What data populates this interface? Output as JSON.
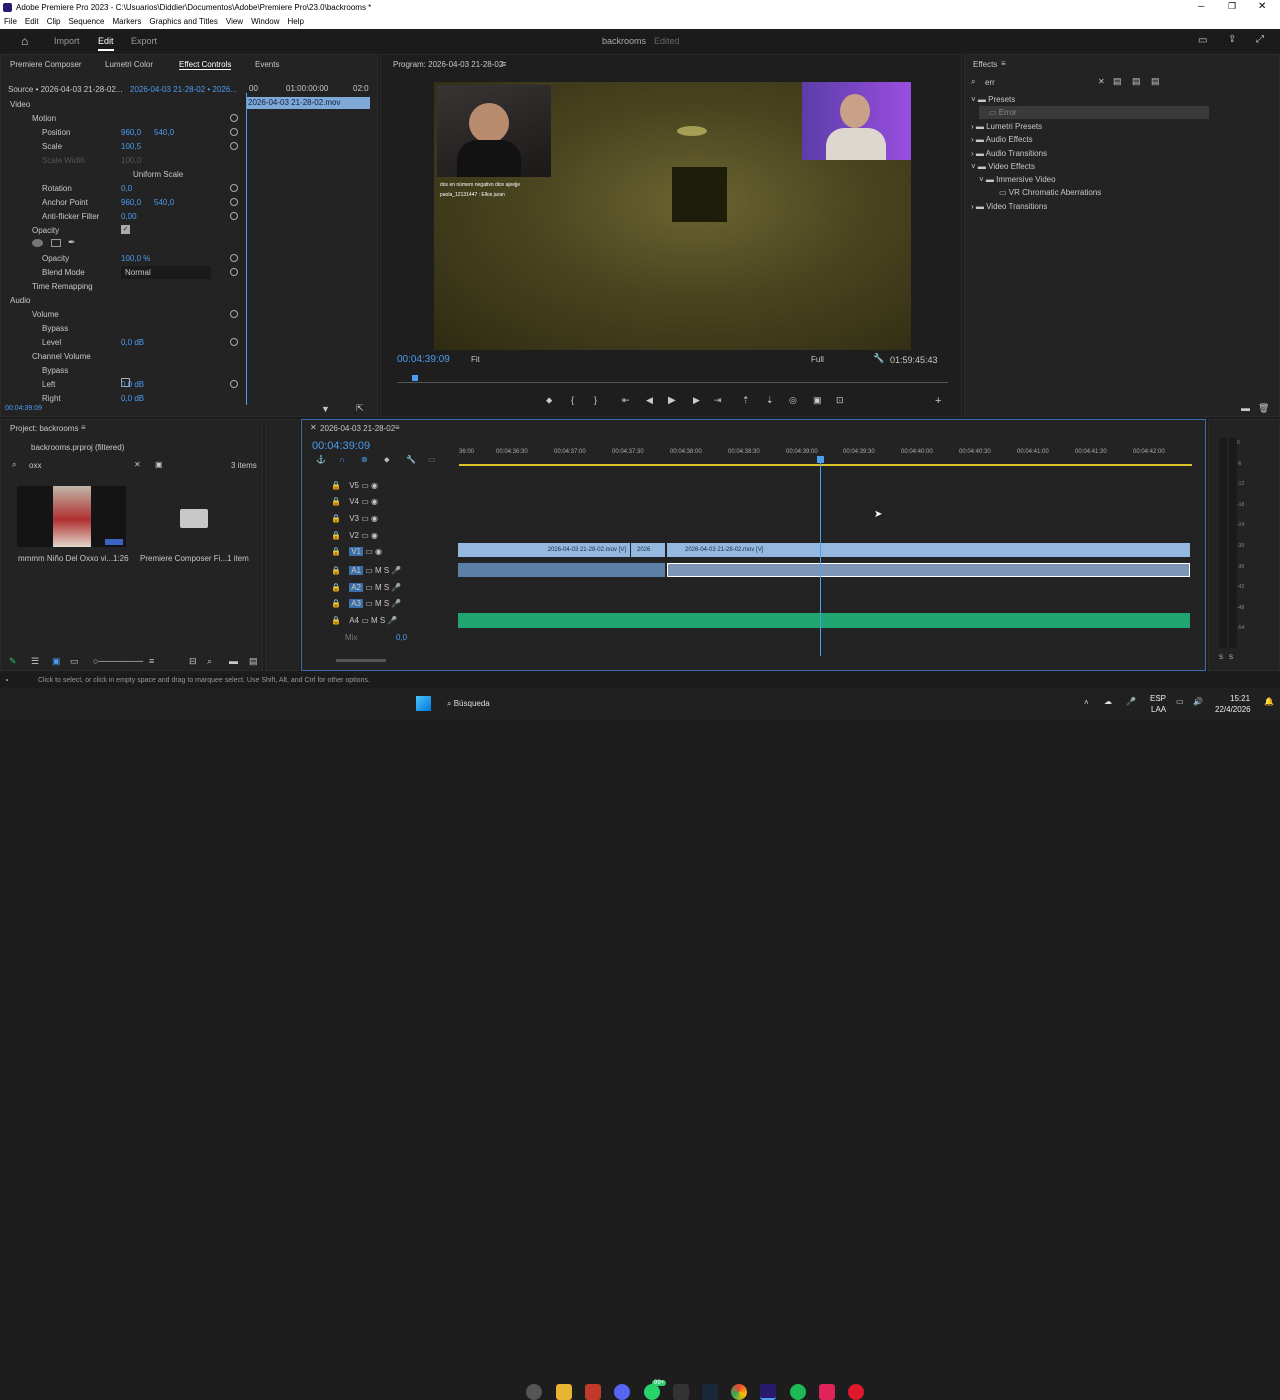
{
  "title": "Adobe Premiere Pro 2023 - C:\\Usuarios\\Diddier\\Documentos\\Adobe\\Premiere Pro\\23.0\\backrooms *",
  "menu": [
    "File",
    "Edit",
    "Clip",
    "Sequence",
    "Markers",
    "Graphics and Titles",
    "View",
    "Window",
    "Help"
  ],
  "header": {
    "tabs": [
      "Import",
      "Edit",
      "Export"
    ],
    "project": "backrooms",
    "status": "Edited"
  },
  "effect_controls": {
    "tabs": [
      "Premiere Composer",
      "Lumetri Color",
      "Effect Controls",
      "Events"
    ],
    "source": "Source • 2026-04-03 21-28-02...",
    "seq": "2026-04-03 21-28-02 • 2026...",
    "time_start": "00",
    "time_mid": "01:00:00:00",
    "time_end": "02:0",
    "clip": "2026-04-03 21-28-02.mov",
    "video": "Video",
    "motion": "Motion",
    "position": "Position",
    "pos_x": "960,0",
    "pos_y": "540,0",
    "scale": "Scale",
    "scale_v": "100,5",
    "scale_width": "Scale Width",
    "scale_width_v": "100,0",
    "uniform": "Uniform Scale",
    "rotation": "Rotation",
    "rotation_v": "0,0",
    "anchor": "Anchor Point",
    "anc_x": "960,0",
    "anc_y": "540,0",
    "antiflicker": "Anti-flicker Filter",
    "antiflicker_v": "0,00",
    "opacity_sec": "Opacity",
    "opacity": "Opacity",
    "opacity_v": "100,0 %",
    "blend": "Blend Mode",
    "blend_v": "Normal",
    "timeremap": "Time Remapping",
    "audio": "Audio",
    "volume": "Volume",
    "bypass": "Bypass",
    "level": "Level",
    "level_v": "0,0 dB",
    "channel_volume": "Channel Volume",
    "bypass2": "Bypass",
    "left": "Left",
    "left_v": "0,0 dB",
    "right": "Right",
    "right_v": "0,0 dB",
    "timecode": "00:04:39:09"
  },
  "program": {
    "title": "Program: 2026-04-03 21-28-02",
    "timecode": "00:04:39:09",
    "fit": "Fit",
    "quality": "Full",
    "duration": "01:59:45:43",
    "chat1": "dos en número negativo dice ajeejje",
    "chat2": "paola_12131447 : Ellos juran"
  },
  "effects": {
    "title": "Effects",
    "search": "err",
    "tree": [
      "Presets",
      "Error",
      "Lumetri Presets",
      "Audio Effects",
      "Audio Transitions",
      "Video Effects",
      "Immersive Video",
      "VR Chromatic Aberrations",
      "Video Transitions"
    ]
  },
  "project": {
    "title": "Project: backrooms",
    "file": "backrooms.prproj (filtered)",
    "search": "oxx",
    "count": "3 items",
    "item1_name": "mmmm Niño Del Oxxo vi...",
    "item1_dur": "1:26",
    "item2_name": "Premiere Composer Fi...",
    "item2_count": "1 item"
  },
  "timeline": {
    "tab": "2026-04-03 21-28-02",
    "timecode": "00:04:39:09",
    "ruler": [
      "36:00",
      "00:04:36:30",
      "00:04:37:00",
      "00:04:37:30",
      "00:04:38:00",
      "00:04:38:30",
      "00:04:39:00",
      "00:04:39:30",
      "00:04:40:00",
      "00:04:40:30",
      "00:04:41:00",
      "00:04:41:30",
      "00:04:42:00"
    ],
    "vtracks": [
      "V5",
      "V4",
      "V3",
      "V2",
      "V1"
    ],
    "atracks": [
      "A1",
      "A2",
      "A3",
      "A4"
    ],
    "mix": "Mix",
    "mix_v": "0,0",
    "clip1": "2026-04-03 21-28-02.mov [V]",
    "clip2": "2026",
    "clip3": "2026-04-03 21-28-02.mov [V]"
  },
  "meter_ticks": [
    "0",
    "-6",
    "-12",
    "-18",
    "-24",
    "-30",
    "-36",
    "-42",
    "-48",
    "-54"
  ],
  "meter_sm": [
    "S",
    "S"
  ],
  "status": "Click to select, or click in empty space and drag to marquee select. Use Shift, Alt, and Ctrl for other options.",
  "taskbar": {
    "search": "Búsqueda",
    "lang": "ESP",
    "region": "LAA",
    "time": "15:21",
    "date": "22/4/2026",
    "badge": "99+"
  }
}
